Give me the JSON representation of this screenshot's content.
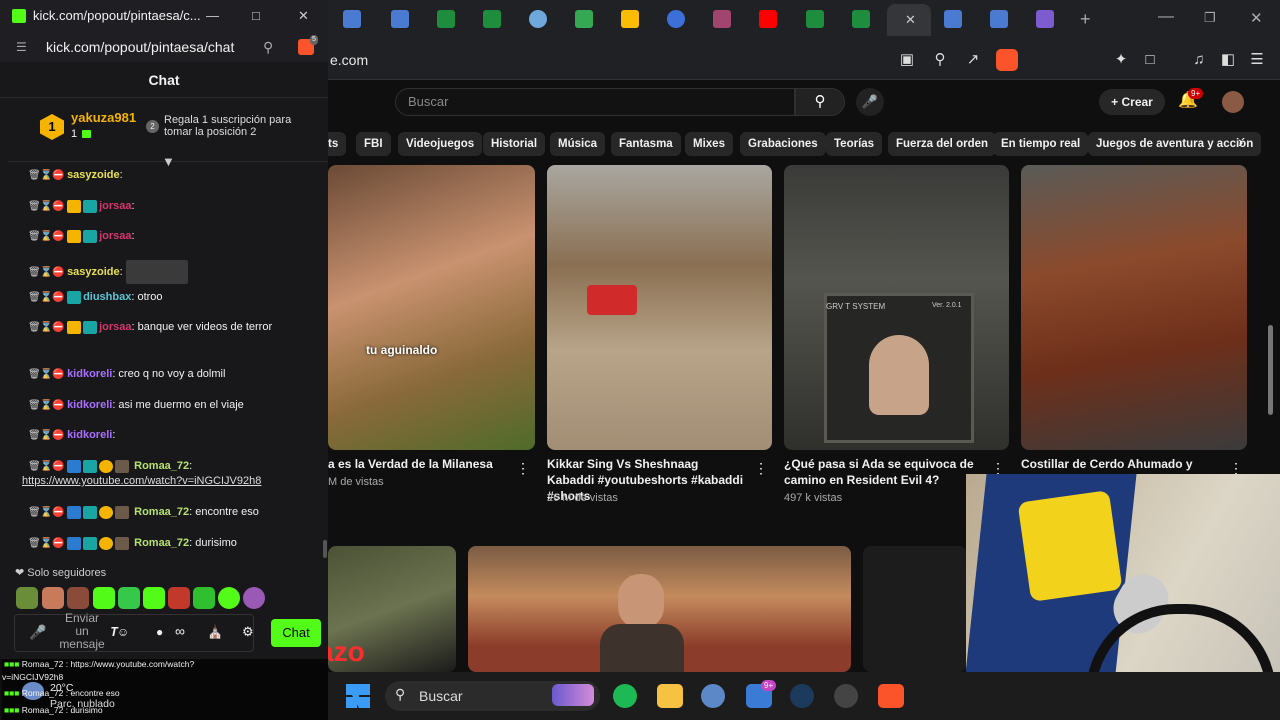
{
  "browser": {
    "url": "e.com",
    "close_label": "✕",
    "new_tab_label": "+"
  },
  "youtube": {
    "search_placeholder": "Buscar",
    "crear_label": "Crear",
    "notifications_badge": "9+",
    "chips": [
      "ts",
      "FBI",
      "Videojuegos",
      "Historial",
      "Música",
      "Fantasma",
      "Mixes",
      "Grabaciones",
      "Teorías",
      "Fuerza del orden",
      "En tiempo real",
      "Juegos de aventura y acción"
    ],
    "videos": [
      {
        "title": "a es la Verdad de la Milanesa",
        "meta": "M de vistas",
        "overlay": "tu aguinaldo"
      },
      {
        "title": "Kikkar Sing Vs Sheshnaag Kabaddi #youtubeshorts #kabaddi #shorts",
        "meta": "26 M de vistas"
      },
      {
        "title": "¿Qué pasa si Ada se equivoca de camino en Resident Evil 4?",
        "meta": "497 k vistas",
        "screen_text": "GRV T SYSTEM",
        "screen_ver": "Ver. 2.0.1"
      },
      {
        "title": "Costillar de Cerdo Ahumado y",
        "meta": ""
      }
    ],
    "shorts_overlay": "azo"
  },
  "popup": {
    "window_title": "kick.com/popout/pintaesa/c...",
    "address": "kick.com/popout/pintaesa/chat",
    "shield_badge": "5",
    "chat_heading": "Chat",
    "pinned": {
      "rank": "1",
      "user": "yakuza981",
      "count": "1",
      "rank_icon": "2",
      "gift_text": "Regala 1 suscripción para tomar la posición 2"
    },
    "messages": [
      {
        "user": "sasyzoide",
        "color": "#e8e050",
        "text": ":"
      },
      {
        "user": "jorsaa",
        "color": "#d4376b",
        "text": ":"
      },
      {
        "user": "jorsaa",
        "color": "#d4376b",
        "text": ":"
      },
      {
        "user": "sasyzoide",
        "color": "#e8e050",
        "text": ":"
      },
      {
        "user": "diushbax",
        "color": "#5bc3d6",
        "text": ": otroo"
      },
      {
        "user": "jorsaa",
        "color": "#d4376b",
        "text": ": banque ver videos de terror"
      },
      {
        "user": "kidkoreli",
        "color": "#a970ff",
        "text": ": creo q no voy a dolmil"
      },
      {
        "user": "kidkoreli",
        "color": "#a970ff",
        "text": ": asi me duermo en el viaje"
      },
      {
        "user": "kidkoreli",
        "color": "#a970ff",
        "text": ":"
      },
      {
        "user": "Romaa_72",
        "color": "#b6e36b",
        "text": ":"
      },
      {
        "user": "Romaa_72",
        "color": "#b6e36b",
        "text": ": encontre eso"
      },
      {
        "user": "Romaa_72",
        "color": "#b6e36b",
        "text": ": durisimo"
      }
    ],
    "link": "https://www.youtube.com/watch?v=iNGCIJV92h8",
    "followers_only": "Solo seguidores",
    "input_placeholder": "Enviar un mensaje",
    "send_label": "Chat"
  },
  "overlay_chat": [
    "Romaa_72 : https://www.youtube.com/watch?",
    "v=iNGCIJV92h8",
    "Romaa_72 : encontre eso",
    "Romaa_72 : durisimo"
  ],
  "weather": {
    "temp": "20°C",
    "desc": "Parc. nublado"
  },
  "taskbar": {
    "search_label": "Buscar",
    "badge": "9+"
  }
}
